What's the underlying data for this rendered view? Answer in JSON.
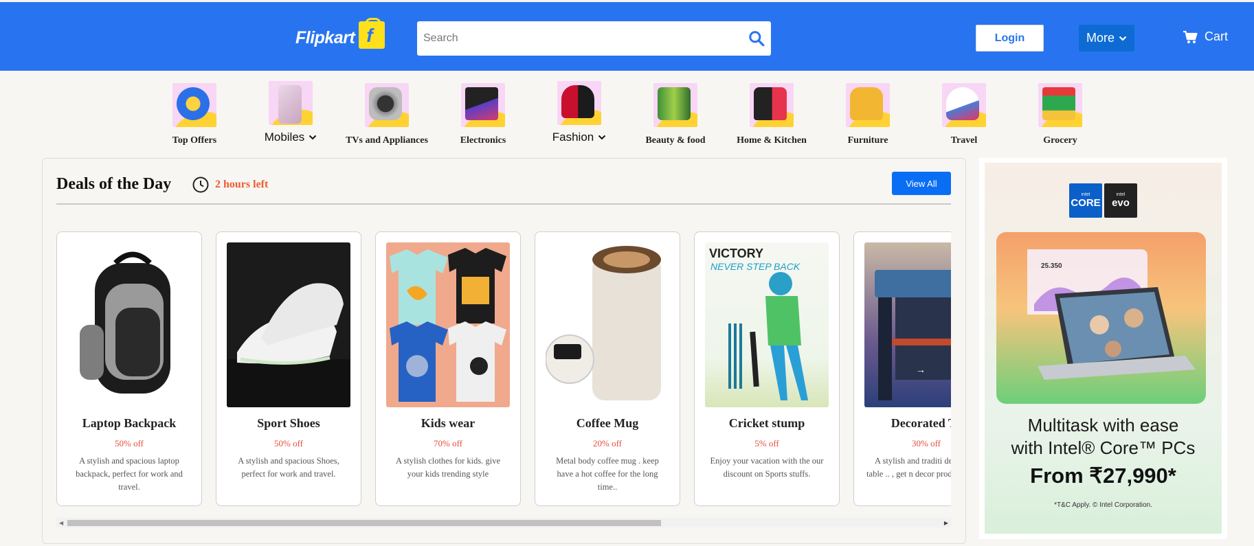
{
  "header": {
    "logo_text": "Flipkart",
    "logo_mark": "f",
    "search_placeholder": "Search",
    "login_label": "Login",
    "more_label": "More",
    "cart_label": "Cart",
    "icons": [
      "search-icon",
      "chevron-down-icon",
      "cart-icon"
    ],
    "colors": {
      "brand_blue": "#2874f0",
      "logo_yellow": "#ffe11b"
    }
  },
  "categories": [
    {
      "label": "Top Offers",
      "icon": "top-offers-icon",
      "dropdown": false
    },
    {
      "label": "Mobiles",
      "icon": "mobiles-icon",
      "dropdown": true
    },
    {
      "label": "TVs and Appliances",
      "icon": "tv-appliances-icon",
      "dropdown": false
    },
    {
      "label": "Electronics",
      "icon": "electronics-icon",
      "dropdown": false
    },
    {
      "label": "Fashion",
      "icon": "fashion-icon",
      "dropdown": true
    },
    {
      "label": "Beauty & food",
      "icon": "beauty-food-icon",
      "dropdown": false
    },
    {
      "label": "Home & Kitchen",
      "icon": "home-kitchen-icon",
      "dropdown": false
    },
    {
      "label": "Furniture",
      "icon": "furniture-icon",
      "dropdown": false
    },
    {
      "label": "Travel",
      "icon": "travel-icon",
      "dropdown": false
    },
    {
      "label": "Grocery",
      "icon": "grocery-icon",
      "dropdown": false
    }
  ],
  "deals": {
    "title": "Deals of the Day",
    "time_left": "2 hours left",
    "view_all_label": "View All",
    "cards": [
      {
        "name": "Laptop Backpack",
        "discount": "50% off",
        "description": "A stylish and spacious laptop backpack, perfect for work and travel."
      },
      {
        "name": "Sport Shoes",
        "discount": "50% off",
        "description": "A stylish and spacious Shoes, perfect for work and travel."
      },
      {
        "name": "Kids wear",
        "discount": "70% off",
        "description": "A stylish clothes for kids. give your kids trending style"
      },
      {
        "name": "Coffee Mug",
        "discount": "20% off",
        "description": "Metal body coffee mug . keep have a hot coffee for the long time.."
      },
      {
        "name": "Cricket stump",
        "discount": "5% off",
        "description": "Enjoy your vacation with the our discount on Sports stuffs."
      },
      {
        "name": "Decorated Ta",
        "discount": "30% off",
        "description": "A stylish and traditi decorated table .. , get n decor product at low"
      }
    ],
    "scroll_fraction": 0.68
  },
  "ad": {
    "badge_core": "CORE",
    "badge_evo": "evo",
    "badge_brand": "intel",
    "hero_figure": "25.350",
    "line1": "Multitask with ease",
    "line2": "with Intel® Core™ PCs",
    "price": "From ₹27,990*",
    "terms": "*T&C Apply. © Intel Corporation."
  }
}
